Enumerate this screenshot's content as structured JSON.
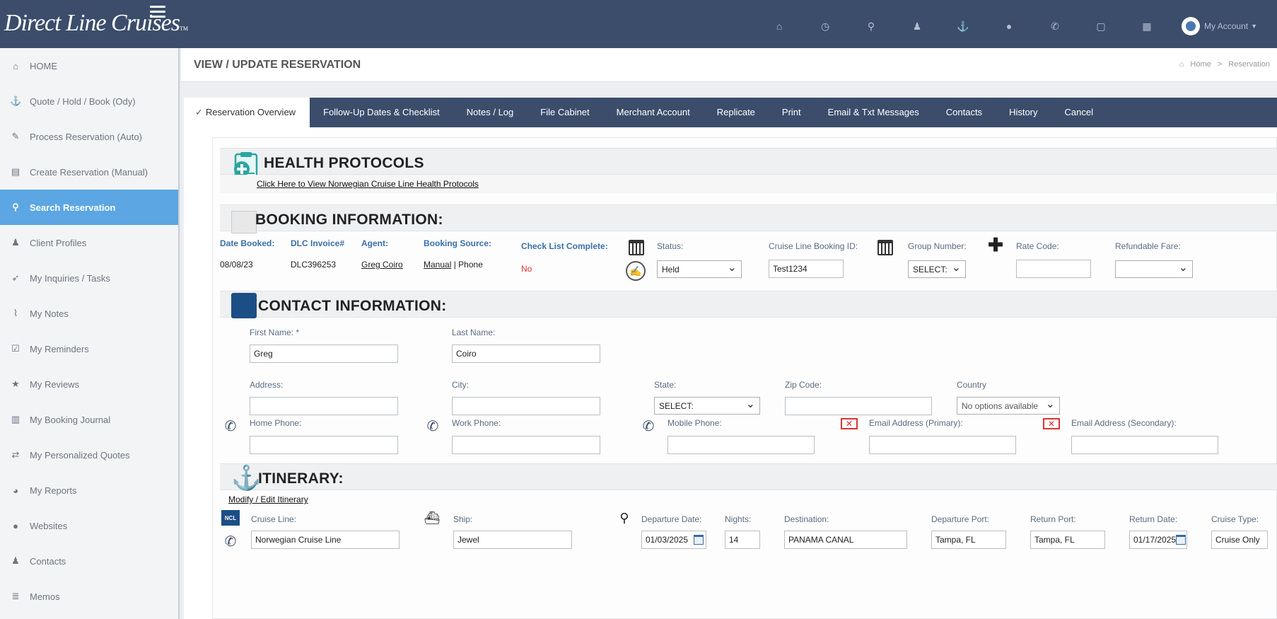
{
  "brand": {
    "logo_text": "Direct Line Cruises",
    "logo_tm": "TM"
  },
  "topbar": {
    "icons": [
      "home-icon",
      "clock-icon",
      "search-icon",
      "person-icon",
      "anchor-icon",
      "globe-icon",
      "phone-icon",
      "chat-icon",
      "calendar-icon"
    ],
    "account_label": "My Account"
  },
  "sidebar": {
    "items": [
      {
        "label": "HOME",
        "icon": "home-icon"
      },
      {
        "label": "Quote / Hold / Book (Ody)",
        "icon": "anchor-icon"
      },
      {
        "label": "Process Reservation (Auto)",
        "icon": "pencil-icon"
      },
      {
        "label": "Create Reservation (Manual)",
        "icon": "document-icon"
      },
      {
        "label": "Search Reservation",
        "icon": "search-icon",
        "active": true
      },
      {
        "label": "Client Profiles",
        "icon": "person-icon"
      },
      {
        "label": "My Inquiries / Tasks",
        "icon": "rocket-icon"
      },
      {
        "label": "My Notes",
        "icon": "paperclip-icon"
      },
      {
        "label": "My Reminders",
        "icon": "checkbox-icon"
      },
      {
        "label": "My Reviews",
        "icon": "star-icon"
      },
      {
        "label": "My Booking Journal",
        "icon": "book-icon"
      },
      {
        "label": "My Personalized Quotes",
        "icon": "exchange-icon"
      },
      {
        "label": "My Reports",
        "icon": "dashboard-icon"
      },
      {
        "label": "Websites",
        "icon": "globe-icon"
      },
      {
        "label": "Contacts",
        "icon": "person-icon"
      },
      {
        "label": "Memos",
        "icon": "list-icon"
      }
    ]
  },
  "page": {
    "title": "VIEW / UPDATE RESERVATION",
    "breadcrumb": {
      "home": "Home",
      "sep": ">",
      "current": "Reservation"
    }
  },
  "tabs": [
    {
      "label": "Reservation Overview",
      "active": true
    },
    {
      "label": "Follow-Up Dates & Checklist"
    },
    {
      "label": "Notes / Log"
    },
    {
      "label": "File Cabinet"
    },
    {
      "label": "Merchant Account"
    },
    {
      "label": "Replicate"
    },
    {
      "label": "Print"
    },
    {
      "label": "Email & Txt Messages"
    },
    {
      "label": "Contacts"
    },
    {
      "label": "History"
    },
    {
      "label": "Cancel"
    }
  ],
  "health": {
    "title": "HEALTH PROTOCOLS",
    "link": "Click Here to View Norwegian Cruise Line Health Protocols"
  },
  "booking": {
    "title": "BOOKING INFORMATION:",
    "date_booked_label": "Date Booked:",
    "date_booked": "08/08/23",
    "invoice_label": "DLC Invoice#",
    "invoice": "DLC396253",
    "agent_label": "Agent:",
    "agent": "Greg Coiro",
    "source_label": "Booking Source:",
    "source_link": "Manual",
    "source_sep": "|",
    "source_type": "Phone",
    "checklist_label": "Check List Complete:",
    "checklist_value": "No",
    "status_label": "Status:",
    "status_value": "Held",
    "cruise_id_label": "Cruise Line Booking ID:",
    "cruise_id_value": "Test1234",
    "group_label": "Group Number:",
    "group_value": "SELECT:",
    "rate_label": "Rate Code:",
    "rate_value": "",
    "refundable_label": "Refundable Fare:",
    "refundable_value": ""
  },
  "contact": {
    "title": "CONTACT INFORMATION:",
    "first_name_label": "First Name: *",
    "first_name": "Greg",
    "last_name_label": "Last Name:",
    "last_name": "Coiro",
    "address_label": "Address:",
    "address": "",
    "city_label": "City:",
    "city": "",
    "state_label": "State:",
    "state": "SELECT:",
    "zip_label": "Zip Code:",
    "zip": "",
    "country_label": "Country",
    "country": "No options available",
    "home_phone_label": "Home Phone:",
    "work_phone_label": "Work Phone:",
    "mobile_phone_label": "Mobile Phone:",
    "email_primary_label": "Email Address (Primary):",
    "email_secondary_label": "Email Address (Secondary):"
  },
  "itinerary": {
    "title": "ITINERARY:",
    "modify_link": "Modify / Edit Itinerary",
    "cruise_line_label": "Cruise Line:",
    "cruise_line": "Norwegian Cruise Line",
    "ncl_badge": "NCL",
    "ship_label": "Ship:",
    "ship": "Jewel",
    "departure_date_label": "Departure Date:",
    "departure_date": "01/03/2025",
    "nights_label": "Nights:",
    "nights": "14",
    "destination_label": "Destination:",
    "destination": "PANAMA CANAL",
    "departure_port_label": "Departure Port:",
    "departure_port": "Tampa, FL",
    "return_port_label": "Return Port:",
    "return_port": "Tampa, FL",
    "return_date_label": "Return Date:",
    "return_date": "01/17/2025",
    "cruise_type_label": "Cruise Type:",
    "cruise_type": "Cruise Only"
  }
}
